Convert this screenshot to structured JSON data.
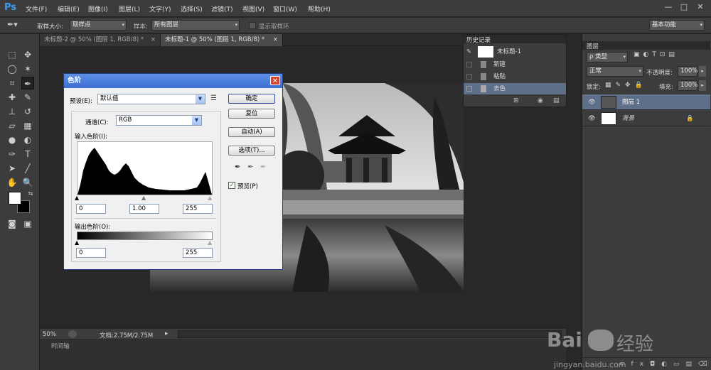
{
  "app": {
    "logo": "Ps",
    "menu": [
      "文件(F)",
      "编辑(E)",
      "图像(I)",
      "图层(L)",
      "文字(Y)",
      "选择(S)",
      "滤镜(T)",
      "视图(V)",
      "窗口(W)",
      "帮助(H)"
    ],
    "window_controls": [
      "—",
      "□",
      "✕"
    ]
  },
  "options_bar": {
    "sample_size_label": "取样大小:",
    "sample_size_value": "取样点",
    "sample_label": "样本:",
    "sample_value": "所有图层",
    "show_ring_label": "显示取样环",
    "workspace_value": "基本功能"
  },
  "tabs": [
    {
      "label": "未标题-2 @ 50% (图层 1, RGB/8) *",
      "close": "×"
    },
    {
      "label": "未标题-1 @ 50% (图层 1, RGB/8) *",
      "close": "×"
    }
  ],
  "status": {
    "zoom": "50%",
    "doc": "文档:2.75M/2.75M"
  },
  "timeline_label": "时间轴",
  "history": {
    "title": "历史记录",
    "snapshot": "未标题-1",
    "items": [
      "新建",
      "粘贴",
      "去色"
    ]
  },
  "layers_panel": {
    "title": "图层",
    "kind_filter": "ρ 类型",
    "blend_mode": "正常",
    "opacity_label": "不透明度:",
    "opacity_value": "100%",
    "lock_label": "锁定:",
    "fill_label": "填充:",
    "fill_value": "100%",
    "layers": [
      {
        "name": "图层 1",
        "selected": true
      },
      {
        "name": "背景",
        "selected": false
      }
    ]
  },
  "levels_dialog": {
    "title": "色阶",
    "preset_label": "预设(E):",
    "preset_value": "默认值",
    "channel_label": "通道(C):",
    "channel_value": "RGB",
    "input_levels_label": "输入色阶(I):",
    "input_black": "0",
    "input_gamma": "1.00",
    "input_white": "255",
    "output_levels_label": "输出色阶(O):",
    "output_black": "0",
    "output_white": "255",
    "ok": "确定",
    "reset": "复位",
    "auto": "自动(A)",
    "options": "选项(T)...",
    "preview_label": "预览(P)",
    "preview_checked": true
  },
  "watermark": {
    "brand": "Bai",
    "brand2": "经验",
    "url": "jingyan.baidu.com"
  },
  "colors": {
    "accent": "#3b9cf1",
    "selection": "#5e6f8a",
    "title_bar": "#3b6fd0"
  }
}
